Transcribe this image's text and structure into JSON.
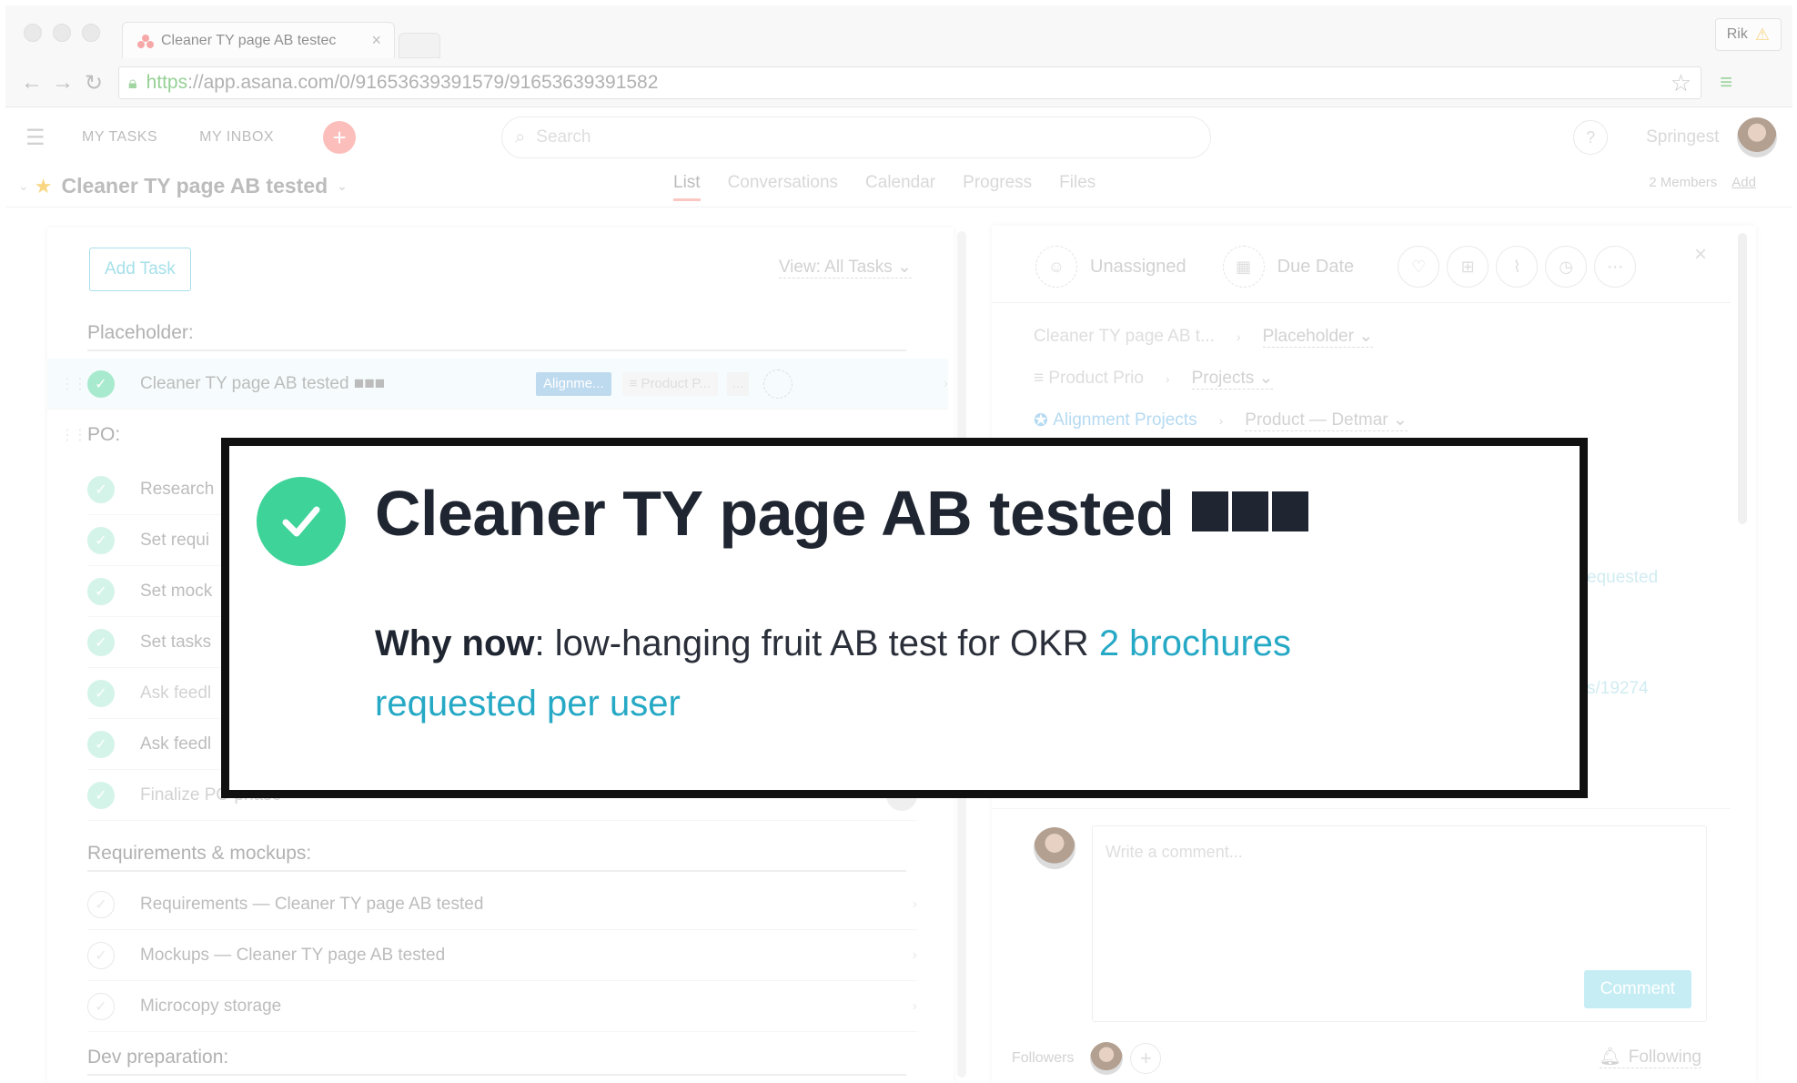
{
  "browser": {
    "tab_title": "Cleaner TY page AB testec",
    "tab_close": "×",
    "user_chip": "Rik",
    "url_protocol": "https",
    "url_rest": "://app.asana.com/0/91653639391579/91653639391582"
  },
  "topbar": {
    "my_tasks": "MY TASKS",
    "my_inbox": "MY INBOX",
    "search_placeholder": "Search",
    "help": "?",
    "org": "Springest"
  },
  "project": {
    "title": "Cleaner TY page AB tested",
    "views": [
      "List",
      "Conversations",
      "Calendar",
      "Progress",
      "Files"
    ],
    "active_view": "List",
    "members": "2 Members",
    "add": "Add"
  },
  "list": {
    "add_task": "Add Task",
    "view_filter": "View: All Tasks",
    "sections": [
      {
        "name": "Placeholder:"
      },
      {
        "name": "PO:"
      },
      {
        "name": "Requirements & mockups:"
      },
      {
        "name": "Dev preparation:"
      }
    ],
    "selected_task": {
      "label": "Cleaner TY page AB tested ■■■",
      "tag_alignment": "Alignme...",
      "tag_product": "≡ Product P...",
      "tag_more": "..."
    },
    "po_tasks": [
      "Research",
      "Set requi",
      "Set mock",
      "Set tasks",
      "Ask feedl",
      "Ask feedl",
      "Finalize PO phase"
    ],
    "req_tasks": [
      "Requirements — Cleaner TY page AB tested",
      "Mockups — Cleaner TY page AB tested",
      "Microcopy storage"
    ]
  },
  "detail": {
    "assignee": "Unassigned",
    "due_date": "Due Date",
    "crumb1_project": "Cleaner TY page AB t...",
    "crumb1_section": "Placeholder",
    "crumb2_project": "≡ Product Prio",
    "crumb2_section": "Projects",
    "crumb3_project": "Alignment Projects",
    "crumb3_section": "Product — Detmar",
    "peek1": "equested",
    "peek2": "s/19274",
    "comment_placeholder": "Write a comment...",
    "comment_button": "Comment",
    "followers_label": "Followers",
    "following": "Following"
  },
  "callout": {
    "title": "Cleaner TY page AB tested",
    "why_label": "Why now",
    "why_text": ": low-hanging fruit AB test for OKR ",
    "link_text": "2 brochures requested per user"
  },
  "colors": {
    "check_green": "#3ed399",
    "link_blue": "#26a9c5",
    "accent_coral": "#fb9c97"
  }
}
